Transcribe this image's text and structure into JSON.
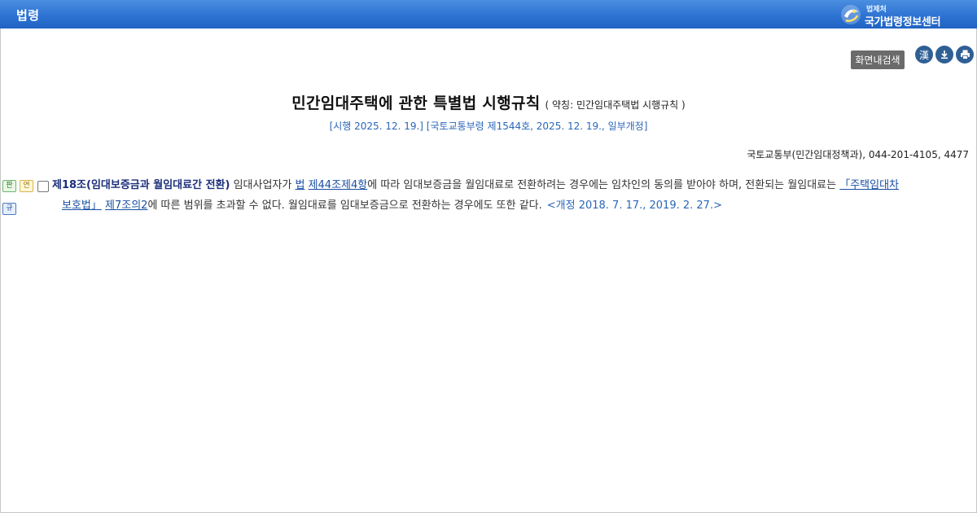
{
  "header": {
    "title": "법령",
    "logo_small": "법제처",
    "logo_main": "국가법령정보센터"
  },
  "toolbar": {
    "search_label": "화면내검색",
    "hanja_label": "漢"
  },
  "law": {
    "title": "민간임대주택에 관한 특별법 시행규칙",
    "abbr": "( 약칭: 민간임대주택법 시행규칙 )",
    "enforcement": "[시행 2025. 12. 19.] [국토교통부령 제1544호, 2025. 12. 19., 일부개정]",
    "ministry": "국토교통부(민간임대정책과), 044-201-4105, 4477"
  },
  "badges": {
    "pan": "판",
    "yeon": "연",
    "gyu": "규"
  },
  "article": {
    "title": "제18조(임대보증금과 월임대료간 전환)",
    "text1": " 임대사업자가 ",
    "link_law": "법",
    "text_space": " ",
    "link_44": "제44조",
    "link_44_4": "제4항",
    "text2": "에 따라 임대보증금을 월임대료로 전환하려는 경우에는 임차인의 동의를 받아야 하며, 전환되는 월임대료는 ",
    "link_housing": "「주택임대차",
    "link_housing2": "보호법」",
    "text3": " ",
    "link_7_2": "제7조의2",
    "text4": "에 따른 범위를 초과할 수 없다. 월임대료를 임대보증금으로 전환하는 경우에도 또한 같다.",
    "amend": "<개정 2018. 7. 17., 2019. 2. 27.>"
  }
}
